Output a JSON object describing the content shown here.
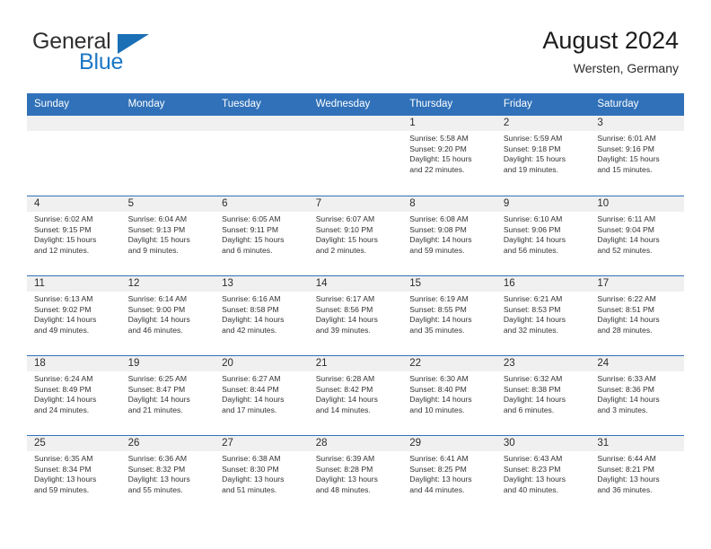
{
  "brand": {
    "line1": "General",
    "line2": "Blue",
    "logo_icon": "triangle-flag-icon",
    "accent_color": "#1b6fb5"
  },
  "header": {
    "title": "August 2024",
    "subtitle": "Wersten, Germany"
  },
  "theme": {
    "header_blue": "#3071b9",
    "daystrip_gray": "#f0f0f0",
    "text": "#333333"
  },
  "weekdays": [
    "Sunday",
    "Monday",
    "Tuesday",
    "Wednesday",
    "Thursday",
    "Friday",
    "Saturday"
  ],
  "labels": {
    "sunrise": "Sunrise:",
    "sunset": "Sunset:",
    "daylight": "Daylight:"
  },
  "weeks": [
    [
      {
        "day": "",
        "empty": true
      },
      {
        "day": "",
        "empty": true
      },
      {
        "day": "",
        "empty": true
      },
      {
        "day": "",
        "empty": true
      },
      {
        "day": "1",
        "sunrise": "Sunrise: 5:58 AM",
        "sunset": "Sunset: 9:20 PM",
        "daylight1": "Daylight: 15 hours",
        "daylight2": "and 22 minutes."
      },
      {
        "day": "2",
        "sunrise": "Sunrise: 5:59 AM",
        "sunset": "Sunset: 9:18 PM",
        "daylight1": "Daylight: 15 hours",
        "daylight2": "and 19 minutes."
      },
      {
        "day": "3",
        "sunrise": "Sunrise: 6:01 AM",
        "sunset": "Sunset: 9:16 PM",
        "daylight1": "Daylight: 15 hours",
        "daylight2": "and 15 minutes."
      }
    ],
    [
      {
        "day": "4",
        "sunrise": "Sunrise: 6:02 AM",
        "sunset": "Sunset: 9:15 PM",
        "daylight1": "Daylight: 15 hours",
        "daylight2": "and 12 minutes."
      },
      {
        "day": "5",
        "sunrise": "Sunrise: 6:04 AM",
        "sunset": "Sunset: 9:13 PM",
        "daylight1": "Daylight: 15 hours",
        "daylight2": "and 9 minutes."
      },
      {
        "day": "6",
        "sunrise": "Sunrise: 6:05 AM",
        "sunset": "Sunset: 9:11 PM",
        "daylight1": "Daylight: 15 hours",
        "daylight2": "and 6 minutes."
      },
      {
        "day": "7",
        "sunrise": "Sunrise: 6:07 AM",
        "sunset": "Sunset: 9:10 PM",
        "daylight1": "Daylight: 15 hours",
        "daylight2": "and 2 minutes."
      },
      {
        "day": "8",
        "sunrise": "Sunrise: 6:08 AM",
        "sunset": "Sunset: 9:08 PM",
        "daylight1": "Daylight: 14 hours",
        "daylight2": "and 59 minutes."
      },
      {
        "day": "9",
        "sunrise": "Sunrise: 6:10 AM",
        "sunset": "Sunset: 9:06 PM",
        "daylight1": "Daylight: 14 hours",
        "daylight2": "and 56 minutes."
      },
      {
        "day": "10",
        "sunrise": "Sunrise: 6:11 AM",
        "sunset": "Sunset: 9:04 PM",
        "daylight1": "Daylight: 14 hours",
        "daylight2": "and 52 minutes."
      }
    ],
    [
      {
        "day": "11",
        "sunrise": "Sunrise: 6:13 AM",
        "sunset": "Sunset: 9:02 PM",
        "daylight1": "Daylight: 14 hours",
        "daylight2": "and 49 minutes."
      },
      {
        "day": "12",
        "sunrise": "Sunrise: 6:14 AM",
        "sunset": "Sunset: 9:00 PM",
        "daylight1": "Daylight: 14 hours",
        "daylight2": "and 46 minutes."
      },
      {
        "day": "13",
        "sunrise": "Sunrise: 6:16 AM",
        "sunset": "Sunset: 8:58 PM",
        "daylight1": "Daylight: 14 hours",
        "daylight2": "and 42 minutes."
      },
      {
        "day": "14",
        "sunrise": "Sunrise: 6:17 AM",
        "sunset": "Sunset: 8:56 PM",
        "daylight1": "Daylight: 14 hours",
        "daylight2": "and 39 minutes."
      },
      {
        "day": "15",
        "sunrise": "Sunrise: 6:19 AM",
        "sunset": "Sunset: 8:55 PM",
        "daylight1": "Daylight: 14 hours",
        "daylight2": "and 35 minutes."
      },
      {
        "day": "16",
        "sunrise": "Sunrise: 6:21 AM",
        "sunset": "Sunset: 8:53 PM",
        "daylight1": "Daylight: 14 hours",
        "daylight2": "and 32 minutes."
      },
      {
        "day": "17",
        "sunrise": "Sunrise: 6:22 AM",
        "sunset": "Sunset: 8:51 PM",
        "daylight1": "Daylight: 14 hours",
        "daylight2": "and 28 minutes."
      }
    ],
    [
      {
        "day": "18",
        "sunrise": "Sunrise: 6:24 AM",
        "sunset": "Sunset: 8:49 PM",
        "daylight1": "Daylight: 14 hours",
        "daylight2": "and 24 minutes."
      },
      {
        "day": "19",
        "sunrise": "Sunrise: 6:25 AM",
        "sunset": "Sunset: 8:47 PM",
        "daylight1": "Daylight: 14 hours",
        "daylight2": "and 21 minutes."
      },
      {
        "day": "20",
        "sunrise": "Sunrise: 6:27 AM",
        "sunset": "Sunset: 8:44 PM",
        "daylight1": "Daylight: 14 hours",
        "daylight2": "and 17 minutes."
      },
      {
        "day": "21",
        "sunrise": "Sunrise: 6:28 AM",
        "sunset": "Sunset: 8:42 PM",
        "daylight1": "Daylight: 14 hours",
        "daylight2": "and 14 minutes."
      },
      {
        "day": "22",
        "sunrise": "Sunrise: 6:30 AM",
        "sunset": "Sunset: 8:40 PM",
        "daylight1": "Daylight: 14 hours",
        "daylight2": "and 10 minutes."
      },
      {
        "day": "23",
        "sunrise": "Sunrise: 6:32 AM",
        "sunset": "Sunset: 8:38 PM",
        "daylight1": "Daylight: 14 hours",
        "daylight2": "and 6 minutes."
      },
      {
        "day": "24",
        "sunrise": "Sunrise: 6:33 AM",
        "sunset": "Sunset: 8:36 PM",
        "daylight1": "Daylight: 14 hours",
        "daylight2": "and 3 minutes."
      }
    ],
    [
      {
        "day": "25",
        "sunrise": "Sunrise: 6:35 AM",
        "sunset": "Sunset: 8:34 PM",
        "daylight1": "Daylight: 13 hours",
        "daylight2": "and 59 minutes."
      },
      {
        "day": "26",
        "sunrise": "Sunrise: 6:36 AM",
        "sunset": "Sunset: 8:32 PM",
        "daylight1": "Daylight: 13 hours",
        "daylight2": "and 55 minutes."
      },
      {
        "day": "27",
        "sunrise": "Sunrise: 6:38 AM",
        "sunset": "Sunset: 8:30 PM",
        "daylight1": "Daylight: 13 hours",
        "daylight2": "and 51 minutes."
      },
      {
        "day": "28",
        "sunrise": "Sunrise: 6:39 AM",
        "sunset": "Sunset: 8:28 PM",
        "daylight1": "Daylight: 13 hours",
        "daylight2": "and 48 minutes."
      },
      {
        "day": "29",
        "sunrise": "Sunrise: 6:41 AM",
        "sunset": "Sunset: 8:25 PM",
        "daylight1": "Daylight: 13 hours",
        "daylight2": "and 44 minutes."
      },
      {
        "day": "30",
        "sunrise": "Sunrise: 6:43 AM",
        "sunset": "Sunset: 8:23 PM",
        "daylight1": "Daylight: 13 hours",
        "daylight2": "and 40 minutes."
      },
      {
        "day": "31",
        "sunrise": "Sunrise: 6:44 AM",
        "sunset": "Sunset: 8:21 PM",
        "daylight1": "Daylight: 13 hours",
        "daylight2": "and 36 minutes."
      }
    ]
  ]
}
